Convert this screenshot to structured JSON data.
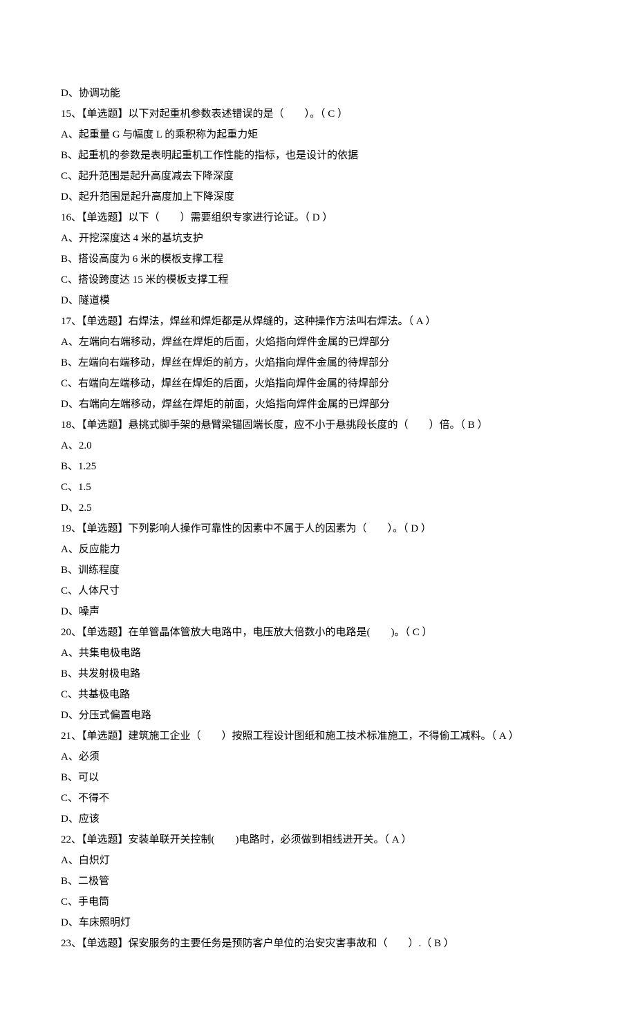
{
  "lines": [
    "D、协调功能",
    "15、【单选题】以下对起重机参数表述错误的是（　　）。（ C ）",
    "A、起重量 G 与幅度 L 的乘积称为起重力矩",
    "B、起重机的参数是表明起重机工作性能的指标，也是设计的依据",
    "C、起升范围是起升高度减去下降深度",
    "D、起升范围是起升高度加上下降深度",
    "16、【单选题】以下（　　）需要组织专家进行论证。（ D ）",
    "A、开挖深度达 4 米的基坑支护",
    "B、搭设高度为 6 米的模板支撑工程",
    "C、搭设跨度达 15 米的模板支撑工程",
    "D、隧道模",
    "17、【单选题】右焊法，焊丝和焊炬都是从焊缝的，这种操作方法叫右焊法。（ A ）",
    "A、左端向右端移动，焊丝在焊炬的后面，火焰指向焊件金属的已焊部分",
    "B、左端向右端移动，焊丝在焊炬的前方，火焰指向焊件金属的待焊部分",
    "C、右端向左端移动，焊丝在焊炬的后面，火焰指向焊件金属的待焊部分",
    "D、右端向左端移动，焊丝在焊炬的前面，火焰指向焊件金属的已焊部分",
    "18、【单选题】悬挑式脚手架的悬臂梁锚固端长度，应不小于悬挑段长度的（　　）倍。（ B ）",
    "A、2.0",
    "B、1.25",
    "C、1.5",
    "D、2.5",
    "19、【单选题】下列影响人操作可靠性的因素中不属于人的因素为（　　）。（ D ）",
    "A、反应能力",
    "B、训练程度",
    "C、人体尺寸",
    "D、噪声",
    "20、【单选题】在单管晶体管放大电路中，电压放大倍数小的电路是(　　)。（ C ）",
    "A、共集电极电路",
    "B、共发射极电路",
    "C、共基极电路",
    "D、分压式偏置电路",
    "21、【单选题】建筑施工企业（　　）按照工程设计图纸和施工技术标准施工，不得偷工减料。（ A ）",
    "A、必须",
    "B、可以",
    "C、不得不",
    "D、应该",
    "22、【单选题】安装单联开关控制(　　)电路时，必须做到相线进开关。（ A ）",
    "A、白炽灯",
    "B、二极管",
    "C、手电筒",
    "D、车床照明灯",
    "23、【单选题】保安服务的主要任务是预防客户单位的治安灾害事故和（　　）.（ B ）"
  ]
}
